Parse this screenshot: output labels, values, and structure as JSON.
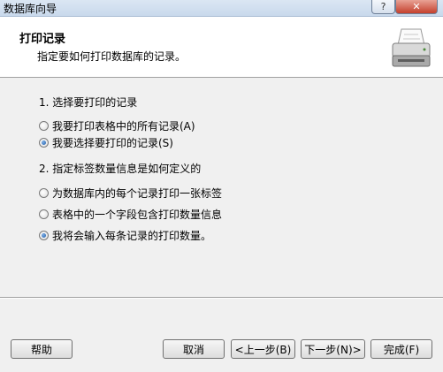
{
  "window": {
    "title": "数据库向导",
    "help_glyph": "?",
    "close_glyph": "✕"
  },
  "header": {
    "title": "打印记录",
    "subtitle": "指定要如何打印数据库的记录。"
  },
  "section1": {
    "label": "1. 选择要打印的记录",
    "options": [
      {
        "label": "我要打印表格中的所有记录(A)",
        "selected": false
      },
      {
        "label": "我要选择要打印的记录(S)",
        "selected": true
      }
    ]
  },
  "section2": {
    "label": "2. 指定标签数量信息是如何定义的",
    "options": [
      {
        "label": "为数据库内的每个记录打印一张标签",
        "selected": false
      },
      {
        "label": "表格中的一个字段包含打印数量信息",
        "selected": false
      },
      {
        "label": "我将会输入每条记录的打印数量。",
        "selected": true
      }
    ]
  },
  "buttons": {
    "help": "帮助",
    "cancel": "取消",
    "back": "<上一步(B)",
    "next": "下一步(N)>",
    "finish": "完成(F)"
  }
}
